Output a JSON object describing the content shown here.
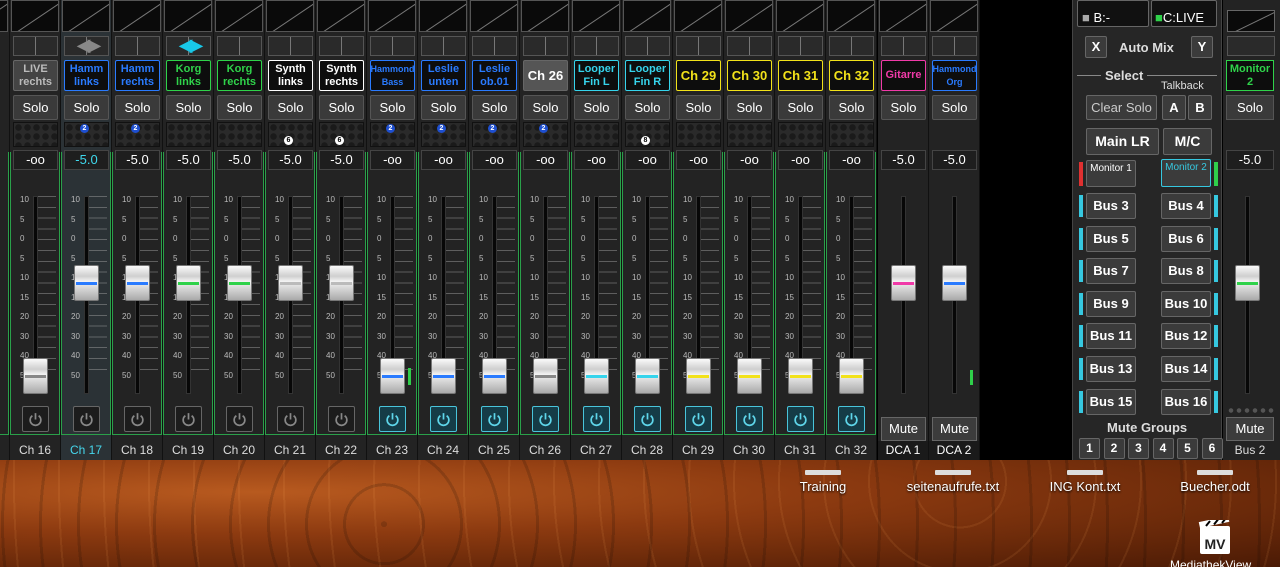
{
  "colors": {
    "accent": "#36c8e0",
    "green": "#2aa04a",
    "bg": "#232323"
  },
  "strips": [
    {
      "id": "ch16",
      "label": "LIVE rechts",
      "name_color": "#bbbbbb",
      "name_bg": "#444",
      "big": false,
      "level": "-oo",
      "ch": "Ch 16",
      "fader": 0.96,
      "line": "#888",
      "power": false,
      "pan": "none"
    },
    {
      "id": "ch17",
      "label": "Hamm links",
      "name_color": "#2a7bff",
      "big": false,
      "level": "-5.0",
      "ch": "Ch 17",
      "fader": 0.41,
      "line": "#2a7bff",
      "power": false,
      "pan": "both",
      "sel": true,
      "badge": "2"
    },
    {
      "id": "ch18",
      "label": "Hamm rechts",
      "name_color": "#2a7bff",
      "big": false,
      "level": "-5.0",
      "ch": "Ch 18",
      "fader": 0.41,
      "line": "#2a7bff",
      "power": false,
      "pan": "none",
      "badge": "2"
    },
    {
      "id": "ch19",
      "label": "Korg links",
      "name_color": "#2fd24a",
      "big": false,
      "level": "-5.0",
      "ch": "Ch 19",
      "fader": 0.41,
      "line": "#2fd24a",
      "power": false,
      "pan": "both"
    },
    {
      "id": "ch20",
      "label": "Korg rechts",
      "name_color": "#2fd24a",
      "big": false,
      "level": "-5.0",
      "ch": "Ch 20",
      "fader": 0.41,
      "line": "#2fd24a",
      "power": false,
      "pan": "none"
    },
    {
      "id": "ch21",
      "label": "Synth links",
      "name_color": "#ffffff",
      "big": false,
      "level": "-5.0",
      "ch": "Ch 21",
      "fader": 0.41,
      "line": "#bbbbbb",
      "power": false,
      "pan": "none",
      "wbadge": "6"
    },
    {
      "id": "ch22",
      "label": "Synth rechts",
      "name_color": "#ffffff",
      "big": false,
      "level": "-5.0",
      "ch": "Ch 22",
      "fader": 0.41,
      "line": "#bbbbbb",
      "power": false,
      "pan": "none",
      "wbadge": "6"
    },
    {
      "id": "ch23",
      "label": "Hammond Bass",
      "name_color": "#2a7bff",
      "small": true,
      "level": "-oo",
      "ch": "Ch 23",
      "fader": 0.96,
      "line": "#2a7bff",
      "power": true,
      "pan": "none",
      "badge": "2",
      "meter": 0.09
    },
    {
      "id": "ch24",
      "label": "Leslie unten",
      "name_color": "#2a7bff",
      "big": false,
      "level": "-oo",
      "ch": "Ch 24",
      "fader": 0.96,
      "line": "#2a7bff",
      "power": true,
      "pan": "none",
      "badge": "2"
    },
    {
      "id": "ch25",
      "label": "Leslie ob.01",
      "name_color": "#2a7bff",
      "big": false,
      "level": "-oo",
      "ch": "Ch 25",
      "fader": 0.96,
      "line": "#2a7bff",
      "power": true,
      "pan": "none",
      "badge": "2"
    },
    {
      "id": "ch26",
      "label": "Ch 26",
      "name_color": "#ffffff",
      "name_bg": "#555",
      "big": true,
      "level": "-oo",
      "ch": "Ch 26",
      "fader": 0.96,
      "line": "#888",
      "power": true,
      "pan": "none",
      "badge": "2"
    },
    {
      "id": "ch27",
      "label": "Looper Fin L",
      "name_color": "#36d4ec",
      "big": false,
      "level": "-oo",
      "ch": "Ch 27",
      "fader": 0.96,
      "line": "#36d4ec",
      "power": true,
      "pan": "none"
    },
    {
      "id": "ch28",
      "label": "Looper Fin R",
      "name_color": "#36d4ec",
      "big": false,
      "level": "-oo",
      "ch": "Ch 28",
      "fader": 0.96,
      "line": "#36d4ec",
      "power": true,
      "pan": "none",
      "wbadge": "8"
    },
    {
      "id": "ch29",
      "label": "Ch 29",
      "name_color": "#f2e21a",
      "big": true,
      "level": "-oo",
      "ch": "Ch 29",
      "fader": 0.96,
      "line": "#f2e21a",
      "power": true,
      "pan": "none"
    },
    {
      "id": "ch30",
      "label": "Ch 30",
      "name_color": "#f2e21a",
      "big": true,
      "level": "-oo",
      "ch": "Ch 30",
      "fader": 0.96,
      "line": "#f2e21a",
      "power": true,
      "pan": "none"
    },
    {
      "id": "ch31",
      "label": "Ch 31",
      "name_color": "#f2e21a",
      "big": true,
      "level": "-oo",
      "ch": "Ch 31",
      "fader": 0.96,
      "line": "#f2e21a",
      "power": true,
      "pan": "none"
    },
    {
      "id": "ch32",
      "label": "Ch 32",
      "name_color": "#f2e21a",
      "big": true,
      "level": "-oo",
      "ch": "Ch 32",
      "fader": 0.96,
      "line": "#f2e21a",
      "power": true,
      "pan": "none"
    },
    {
      "id": "dca1",
      "label": "Gitarre",
      "name_color": "#f03aa8",
      "big": false,
      "level": "-5.0",
      "ch": "DCA 1",
      "fader": 0.41,
      "line": "#f03aa8",
      "dca": true,
      "mute": "Mute"
    },
    {
      "id": "dca2",
      "label": "Hammond Org",
      "name_color": "#2a7bff",
      "small": true,
      "level": "-5.0",
      "ch": "DCA 2",
      "fader": 0.41,
      "line": "#2a7bff",
      "dca": true,
      "mute": "Mute",
      "meter": 0.08
    }
  ],
  "scale": [
    "10",
    "5",
    "0",
    "5",
    "10",
    "15",
    "20",
    "30",
    "40",
    "50"
  ],
  "solo_label": "Solo",
  "panel": {
    "top_left": "B:-",
    "top_right": "C:LIVE",
    "automix_x": "X",
    "automix": "Auto Mix",
    "automix_y": "Y",
    "select": "Select",
    "talkback": "Talkback",
    "clear_solo": "Clear Solo",
    "a": "A",
    "b": "B",
    "main_lr": "Main LR",
    "mc": "M/C",
    "monitor1": "Monitor 1",
    "monitor2": "Monitor 2",
    "buses": [
      "Bus 3",
      "Bus 4",
      "Bus 5",
      "Bus 6",
      "Bus 7",
      "Bus 8",
      "Bus 9",
      "Bus 10",
      "Bus 11",
      "Bus 12",
      "Bus 13",
      "Bus 14",
      "Bus 15",
      "Bus 16"
    ],
    "mute_groups": "Mute Groups",
    "mute_group_nums": [
      "1",
      "2",
      "3",
      "4",
      "5",
      "6"
    ]
  },
  "monitor_strip": {
    "label": "Monitor 2",
    "solo": "Solo",
    "level": "-5.0",
    "mute": "Mute",
    "ch": "Bus 2",
    "fader": 0.41
  },
  "desktop": {
    "icons": [
      "Training",
      "seitenaufrufe.txt",
      "ING Kont.txt",
      "Buecher.odt"
    ],
    "mv_label": "MediathekView"
  }
}
